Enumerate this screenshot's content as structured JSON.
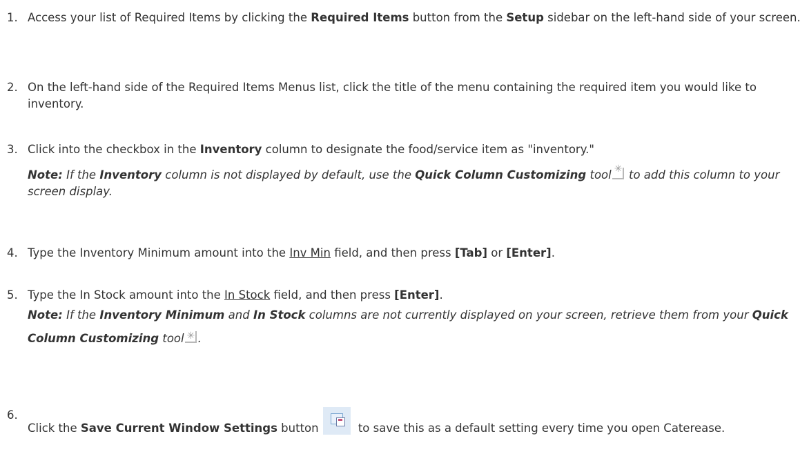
{
  "steps": [
    {
      "num": "1.",
      "t1": "Access your list of Required Items by clicking the ",
      "b1": "Required Items",
      "t2": " button from the ",
      "b2": "Setup",
      "t3": " sidebar on the left-hand side of your screen."
    },
    {
      "num": "2.",
      "text": "On the left-hand side of the Required Items Menus list, click the title of the menu containing the required item you would like to inventory."
    },
    {
      "num": "3.",
      "t1": "Click into the checkbox in the ",
      "b1": "Inventory",
      "t2": " column to designate the food/service item as \"inventory.\"",
      "note": {
        "label": "Note:",
        "t1": " If the ",
        "b1": "Inventory",
        "t2": " column is not displayed by default, use the ",
        "b2": "Quick Column Customizing",
        "t3": " tool",
        "t4": " to add this column to your screen display."
      }
    },
    {
      "num": "4.",
      "t1": "Type the Inventory Minimum amount into the ",
      "u1": "Inv Min",
      "t2": " field, and then press ",
      "b1": "[Tab]",
      "t3": " or ",
      "b2": "[Enter]",
      "t4": "."
    },
    {
      "num": "5.",
      "t1": "Type the In Stock amount into the ",
      "u1": "In Stock",
      "t2": " field, and then press ",
      "b1": "[Enter]",
      "t3": ".",
      "note": {
        "label": "Note:",
        "t1": " If the ",
        "b1": "Inventory Minimum",
        "t2": " and ",
        "b2": "In Stock",
        "t3": " columns are not currently displayed on your screen, retrieve them from your ",
        "b3": "Quick Column Customizing",
        "t4": " tool",
        "t5": "."
      }
    },
    {
      "num": "6.",
      "t1": "Click the ",
      "b1": "Save Current Window Settings",
      "t2": " button",
      "t3": " to save this as a default setting every time you open Caterease."
    }
  ],
  "icons": {
    "quick_column": "quick-column-customizing-icon",
    "save_window": "save-window-settings-icon"
  }
}
